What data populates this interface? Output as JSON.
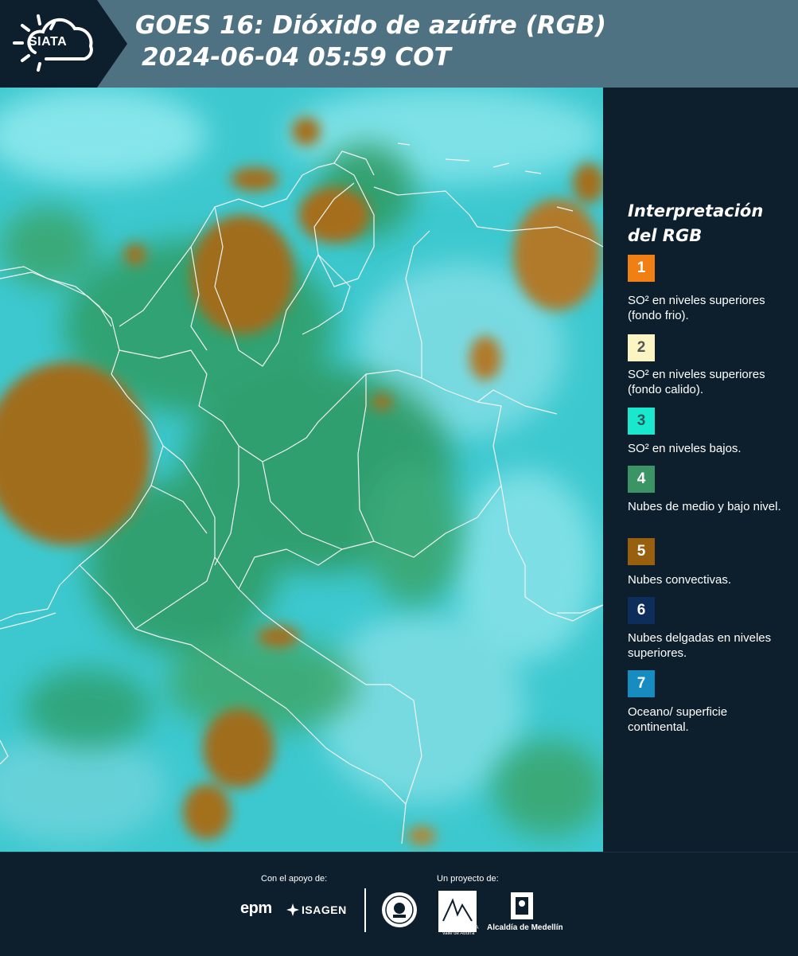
{
  "header": {
    "logo_text": "SIATA",
    "title_line1": "GOES 16: Dióxido de azúfre (RGB)",
    "title_line2": "2024-06-04 05:59 COT"
  },
  "legend": {
    "title_line1": "Interpretación",
    "title_line2": "del RGB",
    "items": [
      {
        "number": "1",
        "color": "#f07f14",
        "num_color": "#ffffff",
        "label": "SO² en niveles superiores (fondo frio)."
      },
      {
        "number": "2",
        "color": "#fbf5c4",
        "num_color": "#555555",
        "label": "SO² en niveles superiores (fondo calido)."
      },
      {
        "number": "3",
        "color": "#19e8cf",
        "num_color": "#2a5b5a",
        "label": "SO² en niveles bajos."
      },
      {
        "number": "4",
        "color": "#3a9463",
        "num_color": "#ffffff",
        "label": "Nubes de medio y bajo nivel."
      },
      {
        "number": "5",
        "color": "#98600e",
        "num_color": "#ffffff",
        "label": "Nubes convectivas."
      },
      {
        "number": "6",
        "color": "#0d2e5a",
        "num_color": "#ffffff",
        "label": "Nubes delgadas en niveles superiores."
      },
      {
        "number": "7",
        "color": "#178cc0",
        "num_color": "#ffffff",
        "label": "Oceano/ superficie continental."
      }
    ]
  },
  "footer": {
    "support_label": "Con el apoyo de:",
    "project_label": "Un proyecto de:",
    "epm": "epm",
    "isagen": "ISAGEN",
    "area_label": "METROPOLITANA Valle de Aburrá",
    "alcaldia": "Alcaldía de Medellín"
  }
}
